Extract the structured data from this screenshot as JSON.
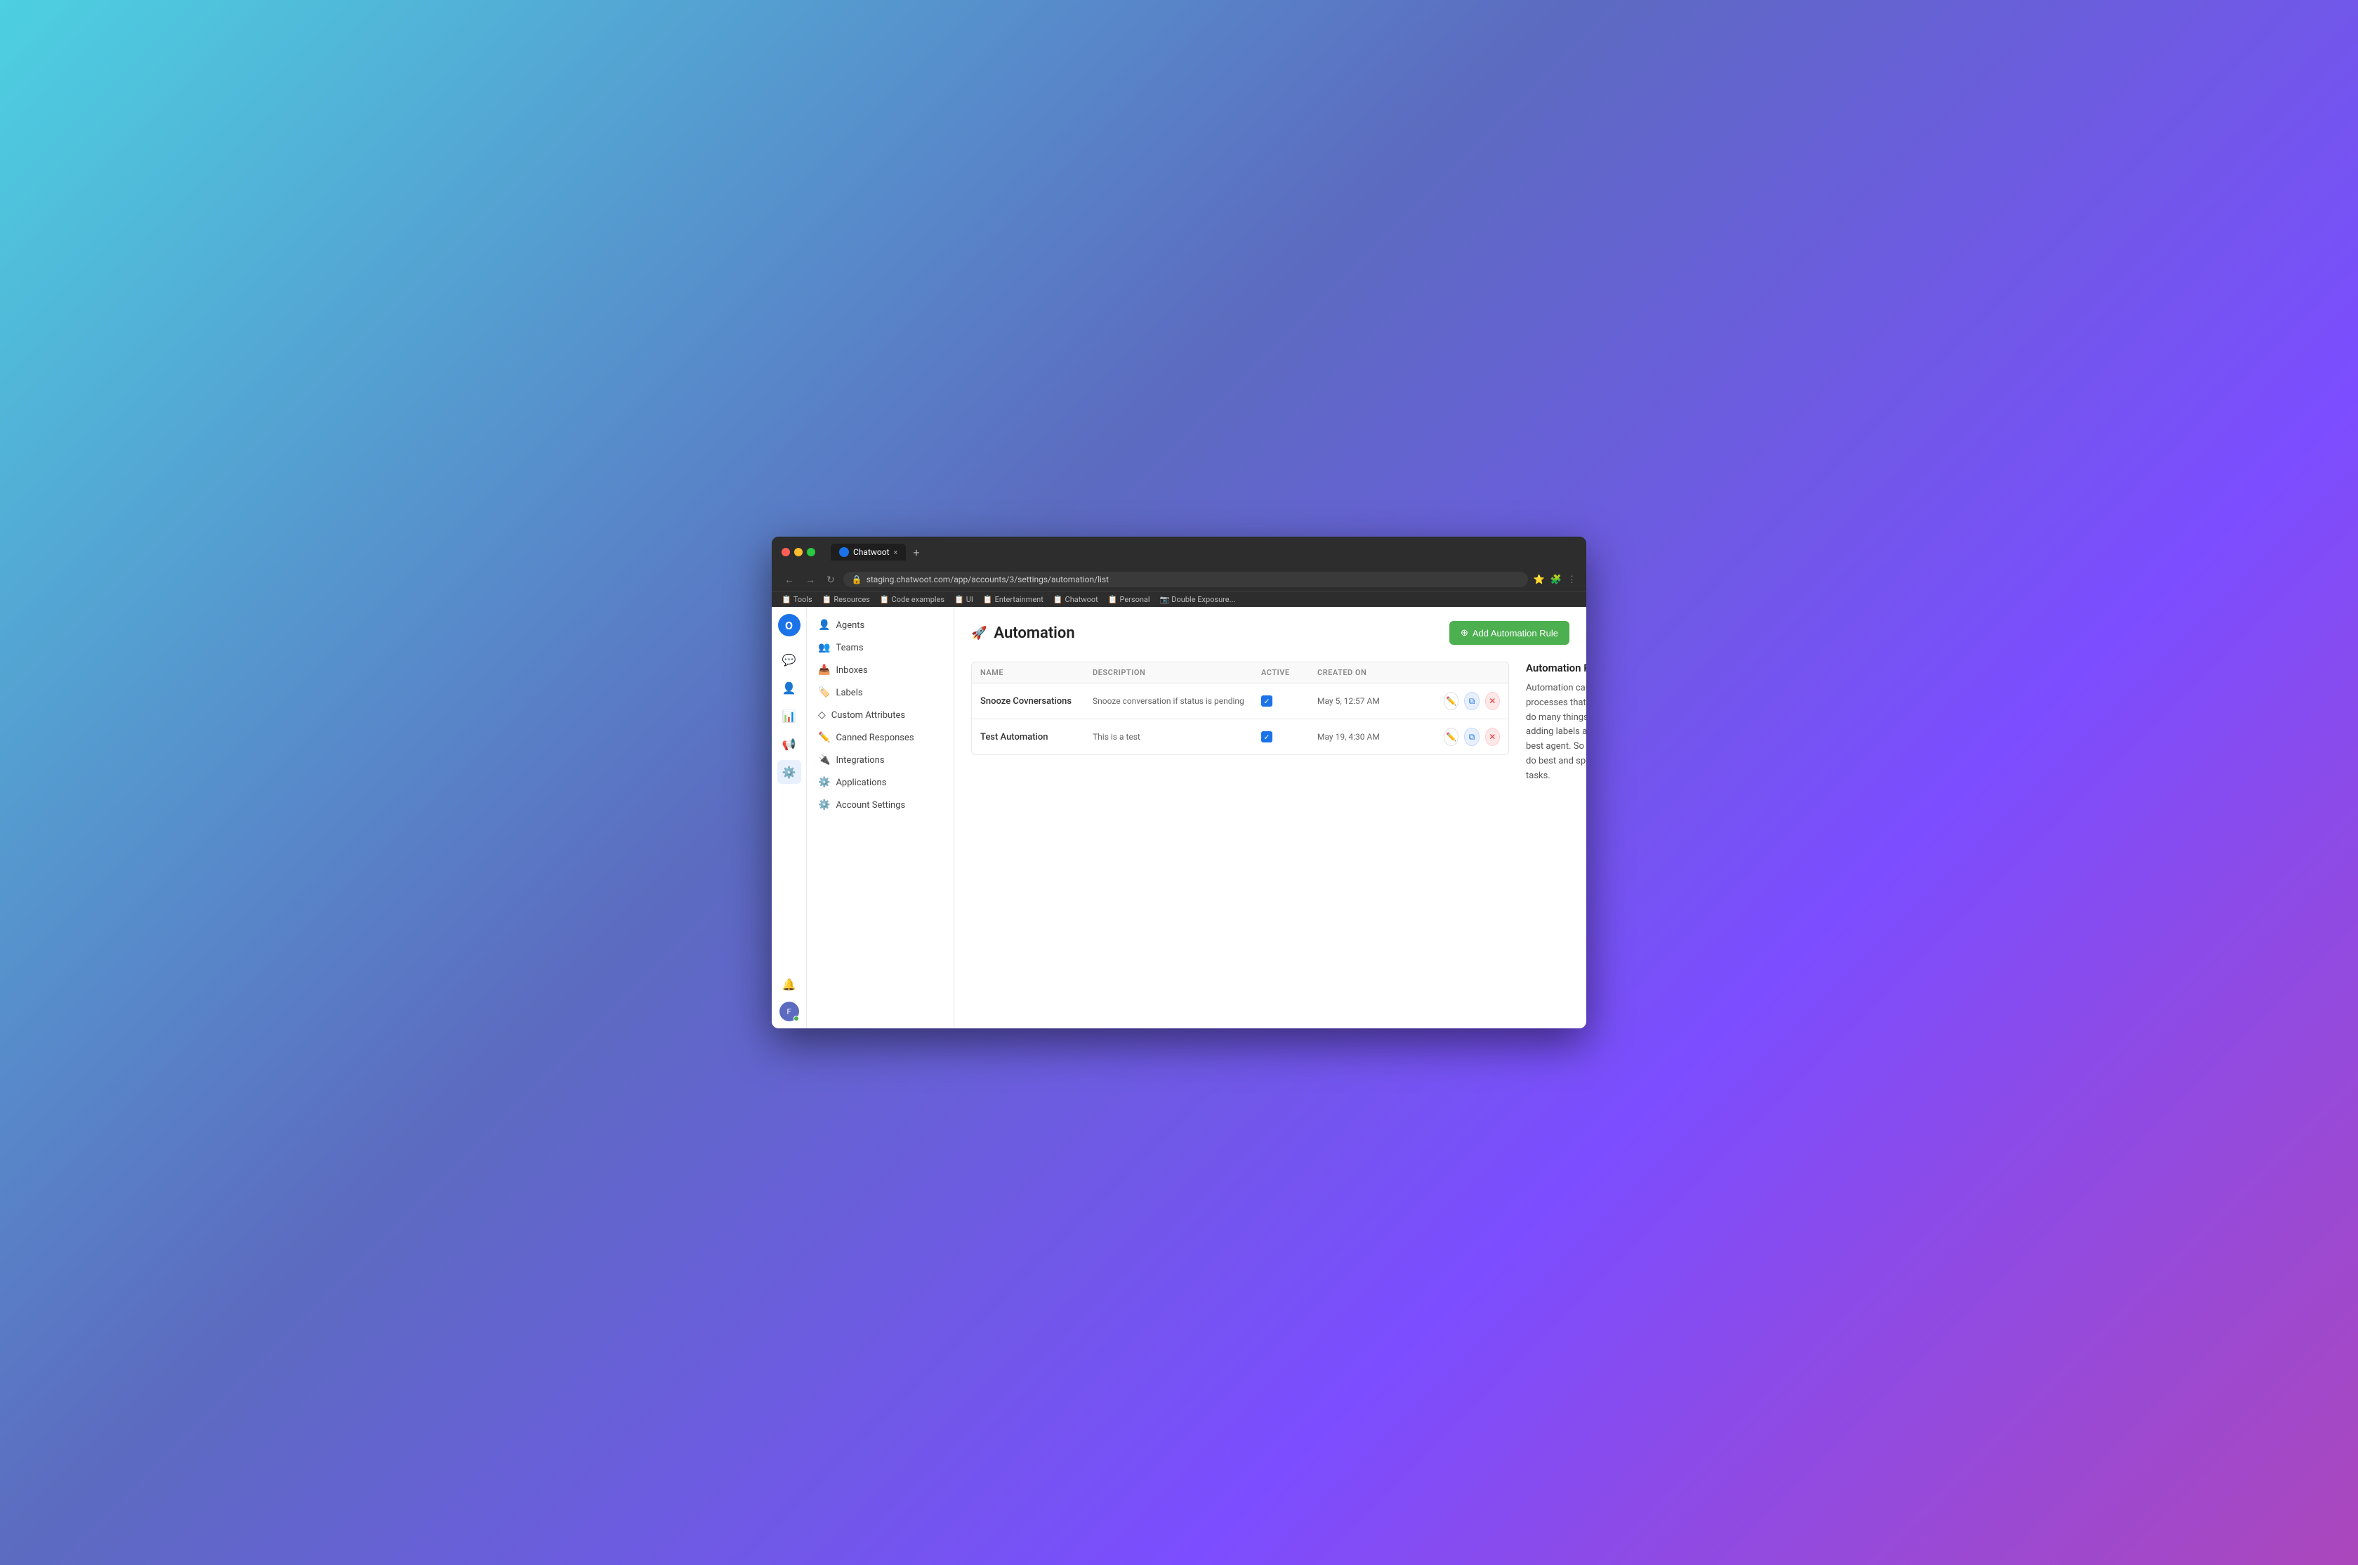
{
  "browser": {
    "tab_title": "Chatwoot",
    "tab_favicon": "C",
    "url": "staging.chatwoot.com/app/accounts/3/settings/automation/list",
    "new_tab_icon": "+",
    "bookmarks": [
      {
        "label": "Tools"
      },
      {
        "label": "Resources"
      },
      {
        "label": "Code examples"
      },
      {
        "label": "UI"
      },
      {
        "label": "Entertainment"
      },
      {
        "label": "Chatwoot"
      },
      {
        "label": "Personal"
      },
      {
        "label": "Double Exposure..."
      }
    ]
  },
  "left_rail": {
    "logo": "O",
    "icons": [
      {
        "name": "chat-icon",
        "symbol": "💬",
        "active": false
      },
      {
        "name": "contacts-icon",
        "symbol": "👤",
        "active": false
      },
      {
        "name": "reports-icon",
        "symbol": "📊",
        "active": false
      },
      {
        "name": "campaigns-icon",
        "symbol": "📢",
        "active": false
      },
      {
        "name": "settings-icon",
        "symbol": "⚙️",
        "active": true
      }
    ]
  },
  "sidebar": {
    "items": [
      {
        "label": "Agents",
        "icon": "👤",
        "active": false
      },
      {
        "label": "Teams",
        "icon": "👥",
        "active": false
      },
      {
        "label": "Inboxes",
        "icon": "📥",
        "active": false
      },
      {
        "label": "Labels",
        "icon": "🏷️",
        "active": false
      },
      {
        "label": "Custom Attributes",
        "icon": "◇",
        "active": false
      },
      {
        "label": "Canned Responses",
        "icon": "✏️",
        "active": false
      },
      {
        "label": "Integrations",
        "icon": "🔌",
        "active": false
      },
      {
        "label": "Applications",
        "icon": "⚙️",
        "active": false
      },
      {
        "label": "Account Settings",
        "icon": "⚙️",
        "active": false
      }
    ]
  },
  "page": {
    "title": "Automation",
    "add_button_label": "Add Automation Rule",
    "add_button_icon": "+"
  },
  "table": {
    "headers": [
      {
        "key": "name",
        "label": "NAME"
      },
      {
        "key": "description",
        "label": "DESCRIPTION"
      },
      {
        "key": "active",
        "label": "ACTIVE"
      },
      {
        "key": "created_on",
        "label": "CREATED ON"
      },
      {
        "key": "actions",
        "label": ""
      }
    ],
    "rows": [
      {
        "name": "Snooze Covnersations",
        "description": "Snooze conversation if status is pending",
        "active": true,
        "created_on": "May 5, 12:57 AM"
      },
      {
        "name": "Test Automation",
        "description": "This is a test",
        "active": true,
        "created_on": "May 19, 4:30 AM"
      }
    ]
  },
  "info_panel": {
    "title": "Automation Rules",
    "description": "Automation can replace and automate existing processes that require manual effort. You can do many things with automation, including adding labels and assigning conversation to the best agent. So the team focuses on what they do best and spends more little time on manual tasks."
  },
  "user": {
    "avatar_letter": "F"
  }
}
